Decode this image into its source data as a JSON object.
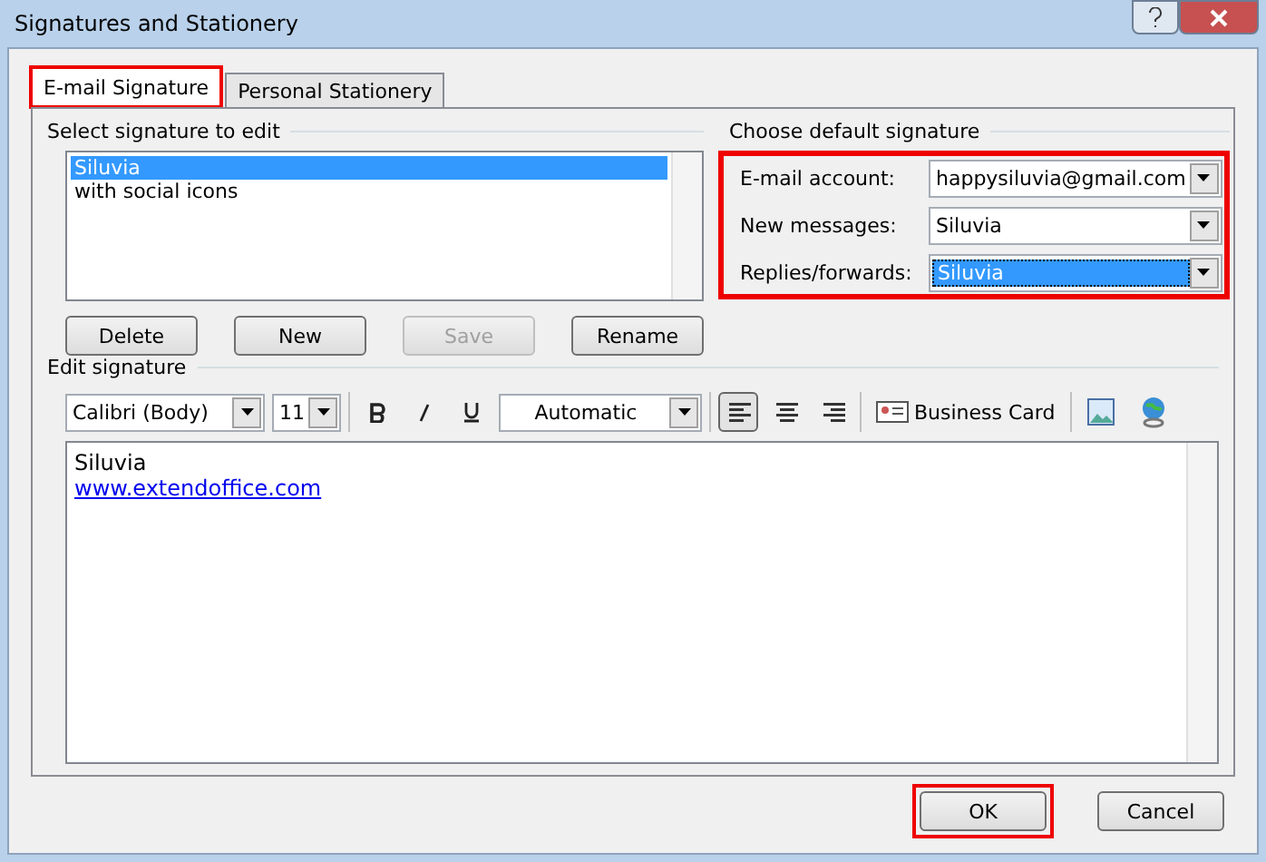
{
  "window": {
    "title": "Signatures and Stationery"
  },
  "tabs": [
    {
      "label": "E-mail Signature",
      "selected": true,
      "highlighted": true
    },
    {
      "label": "Personal Stationery",
      "selected": false,
      "highlighted": false
    }
  ],
  "select_signature": {
    "heading": "Select signature to edit",
    "items": [
      {
        "label": "Siluvia",
        "selected": true
      },
      {
        "label": "with social icons",
        "selected": false
      }
    ],
    "buttons": [
      {
        "label": "Delete",
        "disabled": false
      },
      {
        "label": "New",
        "disabled": false
      },
      {
        "label": "Save",
        "disabled": true
      },
      {
        "label": "Rename",
        "disabled": false
      }
    ]
  },
  "default_signature": {
    "heading": "Choose default signature",
    "highlighted": true,
    "fields": [
      {
        "label": "E-mail account:",
        "value": "happysiluvia@gmail.com",
        "selected": false
      },
      {
        "label": "New messages:",
        "value": "Siluvia",
        "selected": false
      },
      {
        "label": "Replies/forwards:",
        "value": "Siluvia",
        "selected": true
      }
    ]
  },
  "edit_signature": {
    "heading": "Edit signature",
    "font": "Calibri (Body)",
    "size": "11",
    "font_color_label": "Automatic",
    "business_card": "Business Card",
    "alignment": [
      {
        "kind": "left",
        "selected": true
      },
      {
        "kind": "center",
        "selected": false
      },
      {
        "kind": "right",
        "selected": false
      }
    ],
    "lines": [
      {
        "kind": "text",
        "text": "Siluvia"
      },
      {
        "kind": "link",
        "text": "www.extendoffice.com"
      }
    ]
  },
  "footer_buttons": [
    {
      "label": "OK",
      "highlighted": true
    },
    {
      "label": "Cancel",
      "highlighted": false
    }
  ]
}
